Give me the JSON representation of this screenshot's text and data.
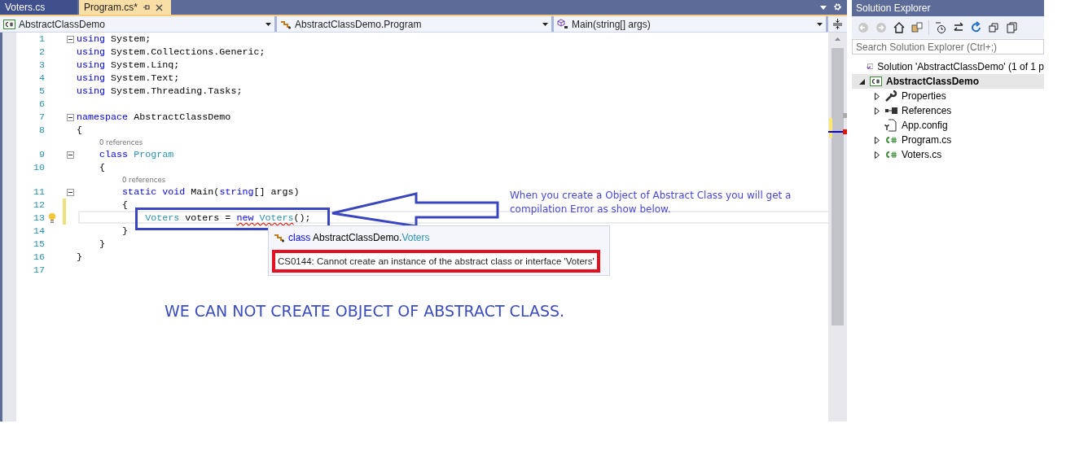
{
  "tabs": [
    {
      "label": "Voters.cs",
      "selected": false
    },
    {
      "label": "Program.cs*",
      "selected": true
    }
  ],
  "nav_bar": {
    "project": "AbstractClassDemo",
    "type": "AbstractClassDemo.Program",
    "member": "Main(string[] args)"
  },
  "code_lines": [
    {
      "kind": "code",
      "number": "1",
      "collapsible": true,
      "changed": false,
      "current": false,
      "tokens": [
        {
          "text": "using",
          "kind": "keyword"
        },
        {
          "text": " System;",
          "kind": "plain"
        }
      ]
    },
    {
      "kind": "code",
      "number": "2",
      "collapsible": false,
      "changed": false,
      "current": false,
      "tokens": [
        {
          "text": "using",
          "kind": "keyword"
        },
        {
          "text": " System.Collections.Generic;",
          "kind": "plain"
        }
      ]
    },
    {
      "kind": "code",
      "number": "3",
      "collapsible": false,
      "changed": false,
      "current": false,
      "tokens": [
        {
          "text": "using",
          "kind": "keyword"
        },
        {
          "text": " System.Linq;",
          "kind": "plain"
        }
      ]
    },
    {
      "kind": "code",
      "number": "4",
      "collapsible": false,
      "changed": false,
      "current": false,
      "tokens": [
        {
          "text": "using",
          "kind": "keyword"
        },
        {
          "text": " System.Text;",
          "kind": "plain"
        }
      ]
    },
    {
      "kind": "code",
      "number": "5",
      "collapsible": false,
      "changed": false,
      "current": false,
      "tokens": [
        {
          "text": "using",
          "kind": "keyword"
        },
        {
          "text": " System.Threading.Tasks;",
          "kind": "plain"
        }
      ]
    },
    {
      "kind": "code",
      "number": "6",
      "collapsible": false,
      "changed": false,
      "current": false
    },
    {
      "kind": "code",
      "number": "7",
      "collapsible": true,
      "changed": false,
      "current": false,
      "tokens": [
        {
          "text": "namespace",
          "kind": "keyword"
        },
        {
          "text": " AbstractClassDemo",
          "kind": "plain"
        }
      ]
    },
    {
      "kind": "code",
      "number": "8",
      "collapsible": false,
      "changed": false,
      "current": false,
      "tokens": [
        {
          "text": "{",
          "kind": "plain"
        }
      ]
    },
    {
      "kind": "lens",
      "text": "0 references"
    },
    {
      "kind": "code",
      "number": "9",
      "collapsible": true,
      "changed": false,
      "current": false,
      "tokens": [
        {
          "text": "    class",
          "kind": "keyword"
        },
        {
          "text": " Program",
          "kind": "type"
        }
      ]
    },
    {
      "kind": "code",
      "number": "10",
      "collapsible": false,
      "changed": false,
      "current": false,
      "tokens": [
        {
          "text": "    {",
          "kind": "plain"
        }
      ]
    },
    {
      "kind": "lens",
      "text": "0 references"
    },
    {
      "kind": "code",
      "number": "11",
      "collapsible": true,
      "changed": false,
      "current": false,
      "tokens": [
        {
          "text": "        static",
          "kind": "keyword"
        },
        {
          "text": " void",
          "kind": "keyword"
        },
        {
          "text": " Main(",
          "kind": "plain"
        },
        {
          "text": "string",
          "kind": "keyword"
        },
        {
          "text": "[] args)",
          "kind": "plain"
        }
      ]
    },
    {
      "kind": "code",
      "number": "12",
      "collapsible": false,
      "changed": true,
      "current": false,
      "tokens": [
        {
          "text": "        {",
          "kind": "plain"
        }
      ]
    },
    {
      "kind": "code",
      "number": "13",
      "collapsible": false,
      "changed": true,
      "current": true,
      "tokens": [
        {
          "text": "            Voters",
          "kind": "type",
          "squiggle": false
        },
        {
          "text": " voters = ",
          "kind": "plain",
          "squiggle": false
        },
        {
          "text": "new",
          "kind": "keyword",
          "squiggle": true
        },
        {
          "text": " Voters",
          "kind": "type",
          "squiggle": true
        },
        {
          "text": "();",
          "kind": "plain",
          "squiggle": false
        }
      ]
    },
    {
      "kind": "code",
      "number": "14",
      "collapsible": false,
      "changed": false,
      "current": false,
      "tokens": [
        {
          "text": "        }",
          "kind": "plain"
        }
      ]
    },
    {
      "kind": "code",
      "number": "15",
      "collapsible": false,
      "changed": false,
      "current": false,
      "tokens": [
        {
          "text": "    }",
          "kind": "plain"
        }
      ]
    },
    {
      "kind": "code",
      "number": "16",
      "collapsible": false,
      "changed": false,
      "current": false,
      "tokens": [
        {
          "text": "}",
          "kind": "plain"
        }
      ]
    },
    {
      "kind": "code",
      "number": "17",
      "collapsible": false,
      "changed": false,
      "current": false
    }
  ],
  "quick_info": {
    "signature": [
      {
        "text": "class",
        "kind": "keyword"
      },
      {
        "text": " AbstractClassDemo.",
        "kind": "plain"
      },
      {
        "text": "Voters",
        "kind": "type"
      }
    ],
    "error": "CS0144: Cannot create an instance of the abstract class or interface 'Voters'"
  },
  "annotation_note": "When you create a Object of Abstract Class you will get a compilation Error as show below.",
  "annotation_heading": "WE CAN NOT CREATE OBJECT OF ABSTRACT CLASS.",
  "solution_explorer": {
    "title": "Solution Explorer",
    "search": {
      "placeholder": "Search Solution Explorer (Ctrl+;)"
    },
    "tree": [
      {
        "label": "Solution 'AbstractClassDemo' (1 of 1 p",
        "kind": "solution",
        "expandable": false,
        "selected": false,
        "children": [
          {
            "label": "AbstractClassDemo",
            "kind": "project",
            "expandable": true,
            "expanded": true,
            "selected": true,
            "children": [
              {
                "label": "Properties",
                "kind": "properties",
                "expandable": true,
                "expanded": false,
                "selected": false
              },
              {
                "label": "References",
                "kind": "references",
                "expandable": true,
                "expanded": false,
                "selected": false
              },
              {
                "label": "App.config",
                "kind": "config",
                "expandable": false,
                "selected": false
              },
              {
                "label": "Program.cs",
                "kind": "csfile",
                "expandable": true,
                "expanded": false,
                "selected": false
              },
              {
                "label": "Voters.cs",
                "kind": "csfile",
                "expandable": true,
                "expanded": false,
                "selected": false
              }
            ]
          }
        ]
      }
    ]
  }
}
